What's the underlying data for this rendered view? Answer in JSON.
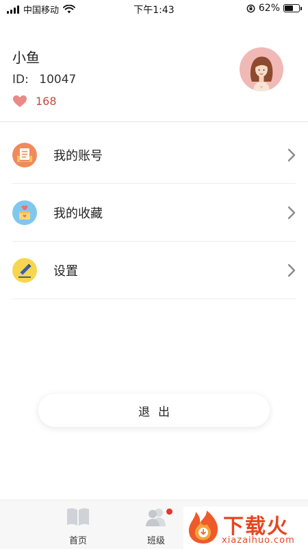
{
  "status_bar": {
    "carrier": "中国移动",
    "time": "下午1:43",
    "battery_percent": "62%",
    "battery_level": 0.62
  },
  "profile": {
    "name": "小鱼",
    "id_label": "ID:",
    "id_value": "10047",
    "likes": "168"
  },
  "menu": {
    "items": [
      {
        "label": "我的账号",
        "icon": "account-book-icon",
        "color": "#ef8a5f"
      },
      {
        "label": "我的收藏",
        "icon": "favorite-box-icon",
        "color": "#7fc7ef"
      },
      {
        "label": "设置",
        "icon": "pencil-settings-icon",
        "color": "#f6d64e"
      }
    ]
  },
  "logout": {
    "label": "退出"
  },
  "tabbar": {
    "items": [
      {
        "label": "首页",
        "icon": "book-icon"
      },
      {
        "label": "班级",
        "icon": "class-people-icon",
        "badge": true
      }
    ]
  },
  "watermark": {
    "title": "下载火",
    "subtitle": "xiazaihuo.com"
  },
  "colors": {
    "accent_red": "#c24b3e",
    "heart": "#ea8a87",
    "badge": "#e8332e"
  }
}
